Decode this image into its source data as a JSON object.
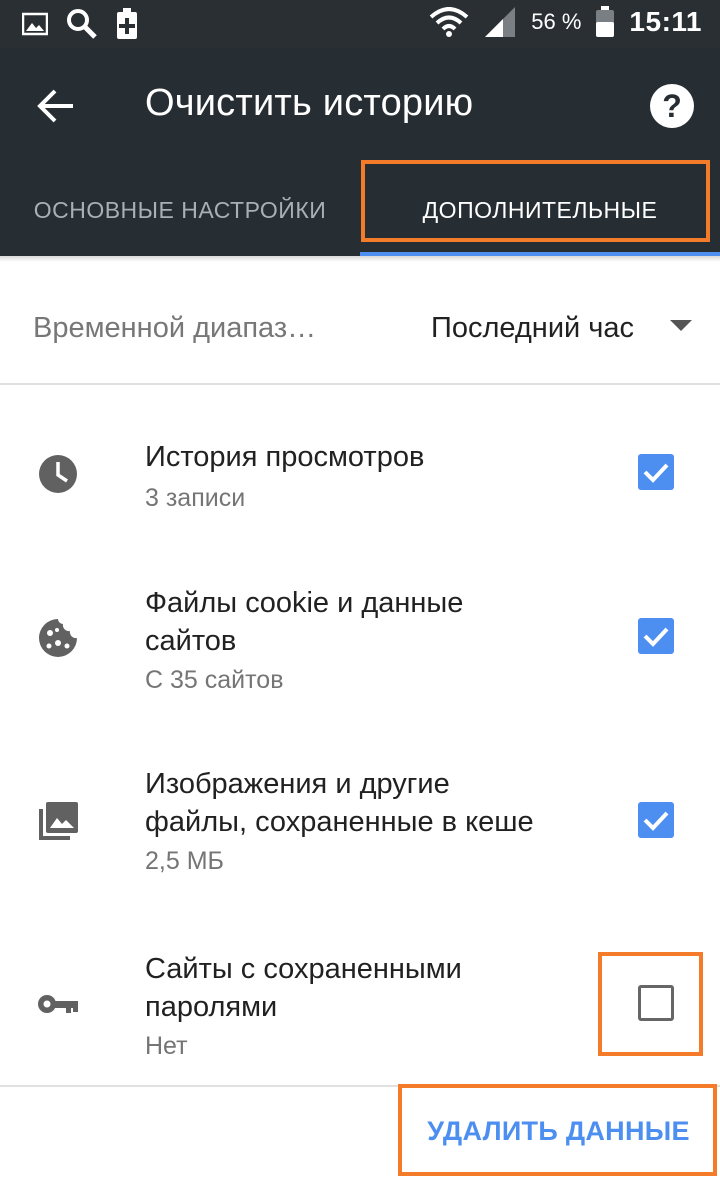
{
  "status_bar": {
    "battery_percent": "56 %",
    "time": "15:11",
    "icons": [
      "image-icon",
      "search-icon",
      "battery-charge-icon",
      "wifi-icon",
      "signal-icon",
      "battery-icon"
    ]
  },
  "toolbar": {
    "title": "Очистить историю",
    "back_icon": "back-arrow-icon",
    "help_icon": "help-icon"
  },
  "tabs": [
    {
      "label": "ОСНОВНЫЕ НАСТРОЙКИ",
      "selected": false
    },
    {
      "label": "ДОПОЛНИТЕЛЬНЫЕ",
      "selected": true
    }
  ],
  "time_range": {
    "label": "Временной диапаз…",
    "value": "Последний час"
  },
  "items": [
    {
      "icon": "clock-icon",
      "title": "История просмотров",
      "subtitle": "3 записи",
      "checked": true
    },
    {
      "icon": "cookie-icon",
      "title": "Файлы cookie и данные сайтов",
      "subtitle": "С 35 сайтов",
      "checked": true
    },
    {
      "icon": "images-icon",
      "title": "Изображения и другие файлы, сохраненные в кеше",
      "subtitle": "2,5 МБ",
      "checked": true
    },
    {
      "icon": "key-icon",
      "title": "Сайты с сохраненными паролями",
      "subtitle": "Нет",
      "checked": false
    }
  ],
  "action": {
    "label": "УДАЛИТЬ ДАННЫЕ"
  },
  "colors": {
    "toolbar": "#262d33",
    "accent": "#4d8ff0",
    "highlight": "#f37b2a"
  }
}
